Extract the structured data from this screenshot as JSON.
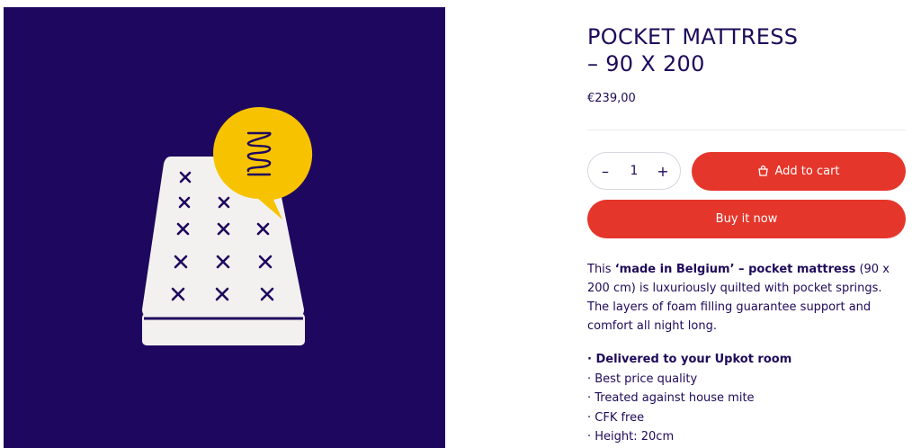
{
  "product": {
    "title_line1": "POCKET MATTRESS",
    "title_line2": "– 90 X 200",
    "price": "€239,00",
    "quantity": "1",
    "decrement_label": "–",
    "increment_label": "+",
    "add_to_cart_label": "Add to cart",
    "buy_now_label": "Buy it now",
    "description": {
      "intro": "This ",
      "bold": "‘made in Belgium’ – pocket mattress",
      "rest": " (90 x 200 cm) is luxuriously quilted with pocket springs. The layers of foam filling guarantee support and comfort all night long."
    },
    "features": [
      "· Delivered to your Upkot room",
      "· Best price quality",
      "· Treated against house mite",
      "· CFK free",
      "· Height: 20cm"
    ]
  },
  "colors": {
    "brand_navy": "#1e075e",
    "accent_red": "#e5362b",
    "badge_yellow": "#f7c300",
    "mattress_white": "#f3f1ef"
  },
  "icons": {
    "cart": "cart-icon",
    "spring": "spring-icon"
  }
}
